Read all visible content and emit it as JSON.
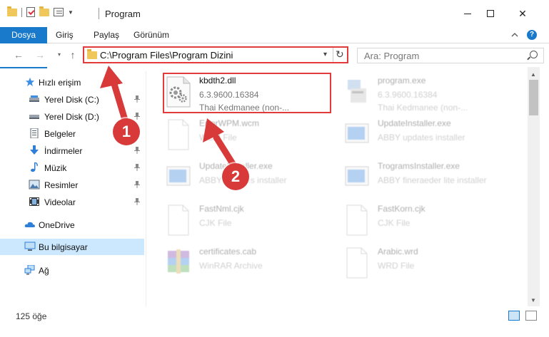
{
  "window": {
    "title": "Program",
    "minimize": "—",
    "close": "✕"
  },
  "ribbon": {
    "file_tab": "Dosya",
    "tabs": [
      "Giriş",
      "Paylaş",
      "Görünüm"
    ],
    "help": "?"
  },
  "nav": {
    "back": "←",
    "forward": "→",
    "recent": "▾",
    "up": "↑",
    "address": "C:\\Program Files\\Program Dizini",
    "address_dropdown": "▾",
    "refresh": "↻",
    "search_placeholder": "Ara: Program"
  },
  "sidebar": {
    "items": [
      {
        "label": "Hızlı erişim",
        "icon": "star-icon"
      },
      {
        "label": "Yerel Disk (C:)",
        "icon": "drive-icon",
        "pinned": true
      },
      {
        "label": "Yerel Disk (D:)",
        "icon": "drive-icon",
        "pinned": true
      },
      {
        "label": "Belgeler",
        "icon": "documents-icon",
        "pinned": true
      },
      {
        "label": "İndirmeler",
        "icon": "download-icon",
        "pinned": true
      },
      {
        "label": "Müzik",
        "icon": "music-icon",
        "pinned": true
      },
      {
        "label": "Resimler",
        "icon": "pictures-icon",
        "pinned": true
      },
      {
        "label": "Videolar",
        "icon": "videos-icon",
        "pinned": true
      },
      {
        "label": "OneDrive",
        "icon": "cloud-icon"
      },
      {
        "label": "Bu bilgisayar",
        "icon": "computer-icon",
        "selected": true
      },
      {
        "label": "Ağ",
        "icon": "network-icon"
      }
    ]
  },
  "files": [
    {
      "name": "kbdth2.dll",
      "line2": "6.3.9600.16384",
      "line3": "Thai Kedmanee (non-...",
      "icon": "dll-gear-icon",
      "highlighted": true
    },
    {
      "name": "program.exe",
      "line2": "6.3.9600.16384",
      "line3": "Thai Kedmanee (non-...",
      "icon": "exe-icon"
    },
    {
      "name": "ErrorWPM.wcm",
      "line2": "WCM File",
      "icon": "generic-file-icon"
    },
    {
      "name": "UpdateInstaller.exe",
      "line2": "ABBY updates installer",
      "icon": "installer-icon"
    },
    {
      "name": "UpdateInstaller.exe",
      "line2": "ABBY updates installer",
      "icon": "installer-icon"
    },
    {
      "name": "TrogramsInstaller.exe",
      "line2": "ABBY fineraeder lite installer",
      "icon": "installer-icon"
    },
    {
      "name": "FastNml.cjk",
      "line2": "CJK File",
      "icon": "generic-file-icon"
    },
    {
      "name": "FastKorn.cjk",
      "line2": "CJK File",
      "icon": "generic-file-icon"
    },
    {
      "name": "certificates.cab",
      "line2": "WinRAR Archive",
      "icon": "archive-icon"
    },
    {
      "name": "Arabic.wrd",
      "line2": "WRD File",
      "icon": "generic-file-icon"
    }
  ],
  "status": {
    "count": "125 öğe"
  },
  "annotations": {
    "step1": "1",
    "step2": "2",
    "color": "#d83a3a"
  },
  "colors": {
    "accent": "#1979ca",
    "highlight_border": "#e23b3b",
    "selected_bg": "#cce8ff"
  }
}
